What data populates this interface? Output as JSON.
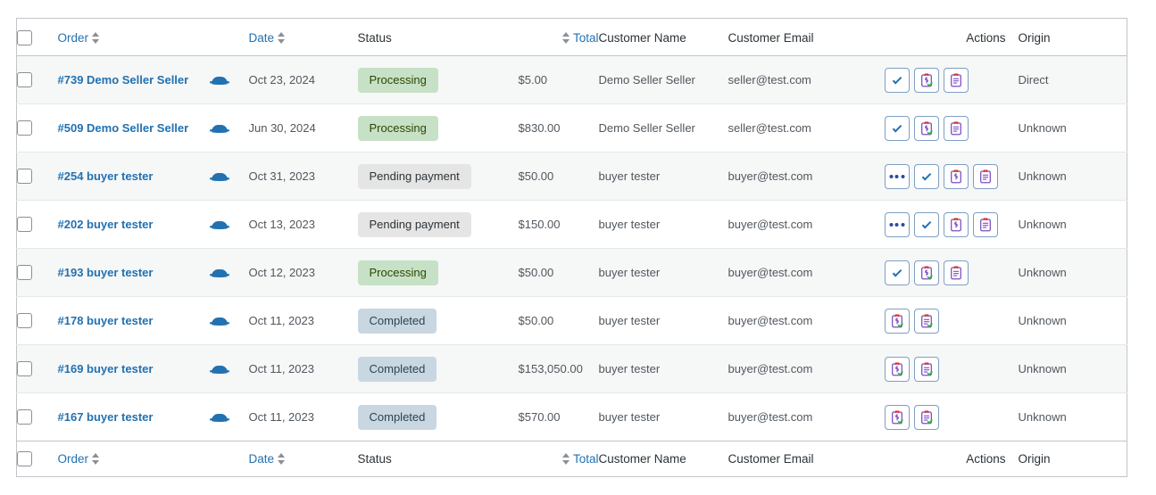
{
  "table": {
    "columns": [
      {
        "key": "cb",
        "label": "",
        "sortable": false,
        "link": false
      },
      {
        "key": "order",
        "label": "Order",
        "sortable": true,
        "link": true
      },
      {
        "key": "preview",
        "label": "",
        "sortable": false,
        "link": false
      },
      {
        "key": "date",
        "label": "Date",
        "sortable": true,
        "link": true
      },
      {
        "key": "status",
        "label": "Status",
        "sortable": false,
        "link": false
      },
      {
        "key": "total",
        "label": "Total",
        "sortable": true,
        "link": true
      },
      {
        "key": "cname",
        "label": "Customer Name",
        "sortable": false,
        "link": false
      },
      {
        "key": "cemail",
        "label": "Customer Email",
        "sortable": false,
        "link": false
      },
      {
        "key": "actions",
        "label": "Actions",
        "sortable": false,
        "link": false
      },
      {
        "key": "origin",
        "label": "Origin",
        "sortable": false,
        "link": false
      }
    ],
    "headers": {
      "order": "Order",
      "date": "Date",
      "status": "Status",
      "total": "Total",
      "customer_name": "Customer Name",
      "customer_email": "Customer Email",
      "actions": "Actions",
      "origin": "Origin"
    },
    "footers": {
      "order": "Order",
      "date": "Date",
      "status": "Status",
      "total": "Total",
      "customer_name": "Customer Name",
      "customer_email": "Customer Email",
      "actions": "Actions",
      "origin": "Origin"
    },
    "rows": [
      {
        "order": "#739 Demo Seller Seller",
        "preview_icon": "eye-icon",
        "date": "Oct 23, 2024",
        "status": "Processing",
        "status_kind": "processing",
        "total": "$5.00",
        "customer_name": "Demo Seller Seller",
        "customer_email": "seller@test.com",
        "origin": "Direct",
        "actions": [
          "complete-check",
          "refund-receipt-done",
          "invoice-doc"
        ]
      },
      {
        "order": "#509 Demo Seller Seller",
        "preview_icon": "eye-icon",
        "date": "Jun 30, 2024",
        "status": "Processing",
        "status_kind": "processing",
        "total": "$830.00",
        "customer_name": "Demo Seller Seller",
        "customer_email": "seller@test.com",
        "origin": "Unknown",
        "actions": [
          "complete-check",
          "refund-receipt-done",
          "invoice-doc"
        ]
      },
      {
        "order": "#254 buyer tester",
        "preview_icon": "eye-icon",
        "date": "Oct 31, 2023",
        "status": "Pending payment",
        "status_kind": "pending",
        "total": "$50.00",
        "customer_name": "buyer tester",
        "customer_email": "buyer@test.com",
        "origin": "Unknown",
        "actions": [
          "more-dots",
          "complete-check",
          "refund-receipt",
          "invoice-doc"
        ]
      },
      {
        "order": "#202 buyer tester",
        "preview_icon": "eye-icon",
        "date": "Oct 13, 2023",
        "status": "Pending payment",
        "status_kind": "pending",
        "total": "$150.00",
        "customer_name": "buyer tester",
        "customer_email": "buyer@test.com",
        "origin": "Unknown",
        "actions": [
          "more-dots",
          "complete-check",
          "refund-receipt",
          "invoice-doc"
        ]
      },
      {
        "order": "#193 buyer tester",
        "preview_icon": "eye-icon",
        "date": "Oct 12, 2023",
        "status": "Processing",
        "status_kind": "processing",
        "total": "$50.00",
        "customer_name": "buyer tester",
        "customer_email": "buyer@test.com",
        "origin": "Unknown",
        "actions": [
          "complete-check",
          "refund-receipt-done",
          "invoice-doc"
        ]
      },
      {
        "order": "#178 buyer tester",
        "preview_icon": "eye-icon",
        "date": "Oct 11, 2023",
        "status": "Completed",
        "status_kind": "completed",
        "total": "$50.00",
        "customer_name": "buyer tester",
        "customer_email": "buyer@test.com",
        "origin": "Unknown",
        "actions": [
          "refund-receipt-done",
          "invoice-doc-done"
        ]
      },
      {
        "order": "#169 buyer tester",
        "preview_icon": "eye-icon",
        "date": "Oct 11, 2023",
        "status": "Completed",
        "status_kind": "completed",
        "total": "$153,050.00",
        "customer_name": "buyer tester",
        "customer_email": "buyer@test.com",
        "origin": "Unknown",
        "actions": [
          "refund-receipt-done",
          "invoice-doc-done"
        ]
      },
      {
        "order": "#167 buyer tester",
        "preview_icon": "eye-icon",
        "date": "Oct 11, 2023",
        "status": "Completed",
        "status_kind": "completed",
        "total": "$570.00",
        "customer_name": "buyer tester",
        "customer_email": "buyer@test.com",
        "origin": "Unknown",
        "actions": [
          "refund-receipt-done",
          "invoice-doc-done"
        ]
      }
    ]
  },
  "colors": {
    "link": "#2271b1",
    "status_processing_bg": "#c6e1c6",
    "status_pending_bg": "#e5e5e5",
    "status_completed_bg": "#c8d7e1",
    "row_alt_bg": "#f6f7f7",
    "border": "#c3c4c7",
    "action_border": "#7d9fc4"
  }
}
